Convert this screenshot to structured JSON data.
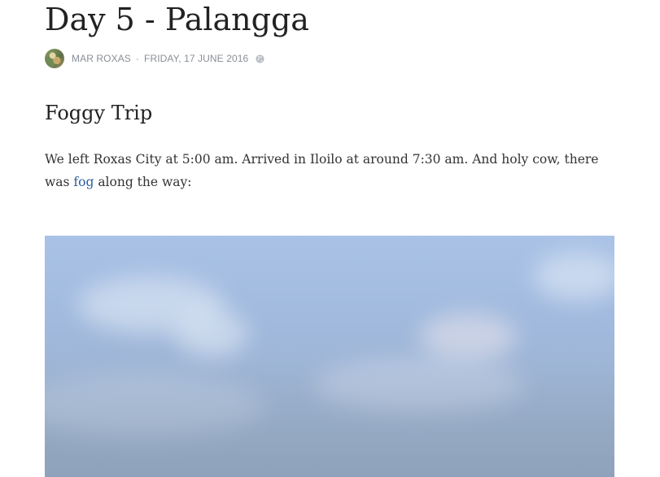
{
  "post": {
    "title": "Day 5 - Palangga",
    "meta": {
      "author": "MAR ROXAS",
      "separator": "·",
      "date": "FRIDAY, 17 JUNE 2016",
      "visibility_icon": "globe-icon"
    },
    "section_heading": "Foggy Trip",
    "paragraph": {
      "text_before_link": "We left Roxas City at 5:00 am. Arrived in Iloilo at around 7:30 am. And holy cow, there was ",
      "link_text": "fog",
      "text_after_link": " along the way:"
    },
    "photo": {
      "alt": "foggy sky"
    }
  },
  "colors": {
    "title": "#222222",
    "meta": "#8a8f98",
    "link": "#2a5d9a",
    "body_text": "#333333",
    "sky": "#a9c2e6"
  }
}
